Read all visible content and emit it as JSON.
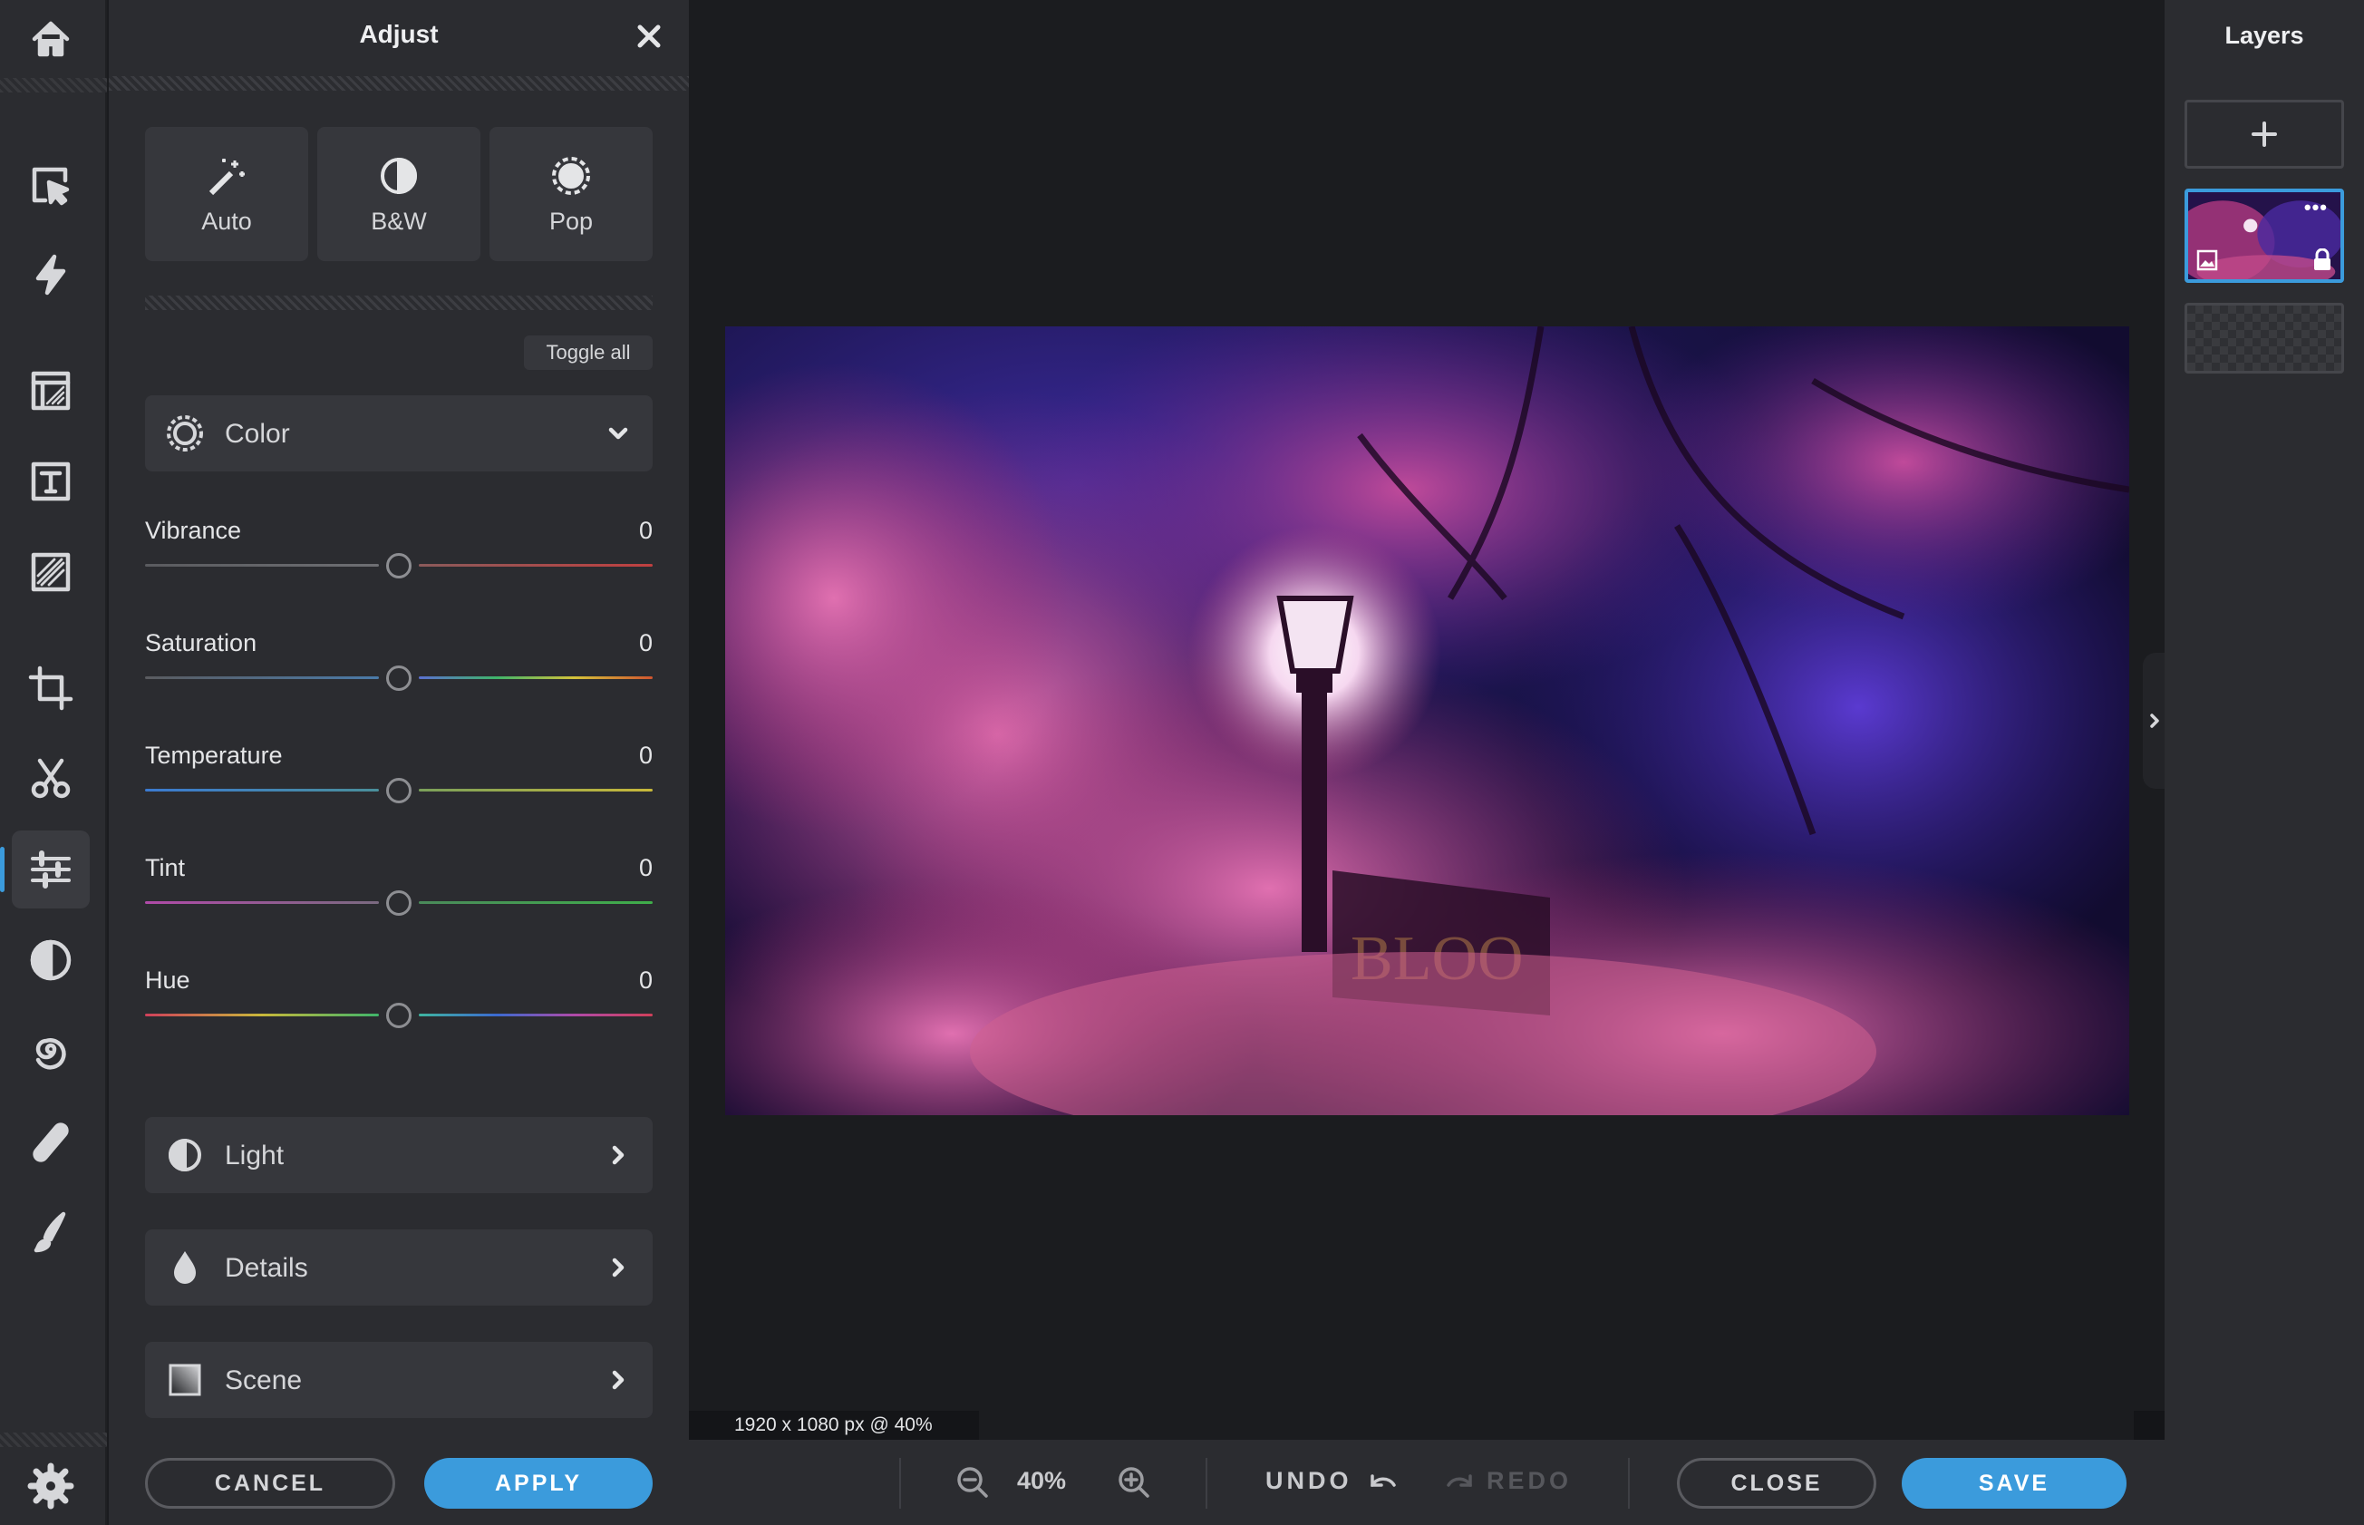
{
  "panel": {
    "title": "Adjust",
    "presets": [
      {
        "label": "Auto",
        "icon": "magic-wand-icon"
      },
      {
        "label": "B&W",
        "icon": "contrast-icon"
      },
      {
        "label": "Pop",
        "icon": "pop-sun-icon"
      }
    ],
    "toggle_all": "Toggle all",
    "color_section": {
      "label": "Color",
      "icon": "color-icon",
      "expanded": true
    },
    "sliders": [
      {
        "label": "Vibrance",
        "value": "0"
      },
      {
        "label": "Saturation",
        "value": "0"
      },
      {
        "label": "Temperature",
        "value": "0"
      },
      {
        "label": "Tint",
        "value": "0"
      },
      {
        "label": "Hue",
        "value": "0"
      }
    ],
    "sections": [
      {
        "label": "Light",
        "icon": "light-icon"
      },
      {
        "label": "Details",
        "icon": "drop-icon"
      },
      {
        "label": "Scene",
        "icon": "scene-icon"
      }
    ],
    "cancel_label": "CANCEL",
    "apply_label": "APPLY"
  },
  "rail": {
    "items": [
      {
        "name": "home-icon"
      },
      {
        "name": "arrange-icon"
      },
      {
        "name": "quick-actions-icon"
      },
      {
        "name": "templates-icon"
      },
      {
        "name": "text-icon"
      },
      {
        "name": "graphics-icon"
      },
      {
        "name": "crop-icon"
      },
      {
        "name": "cutout-icon"
      },
      {
        "name": "adjust-icon",
        "active": true
      },
      {
        "name": "filters-icon"
      },
      {
        "name": "liquify-icon"
      },
      {
        "name": "retouch-icon"
      },
      {
        "name": "draw-icon"
      },
      {
        "name": "settings-icon"
      }
    ]
  },
  "canvas": {
    "image_info": "1920 x 1080 px @ 40%"
  },
  "layers": {
    "title": "Layers"
  },
  "bottombar": {
    "zoom": "40%",
    "undo_label": "UNDO",
    "redo_label": "REDO",
    "close_label": "CLOSE",
    "save_label": "SAVE"
  },
  "colors": {
    "accent": "#3b9bdc",
    "panel": "#2b2c30",
    "canvas": "#1b1c1f"
  }
}
